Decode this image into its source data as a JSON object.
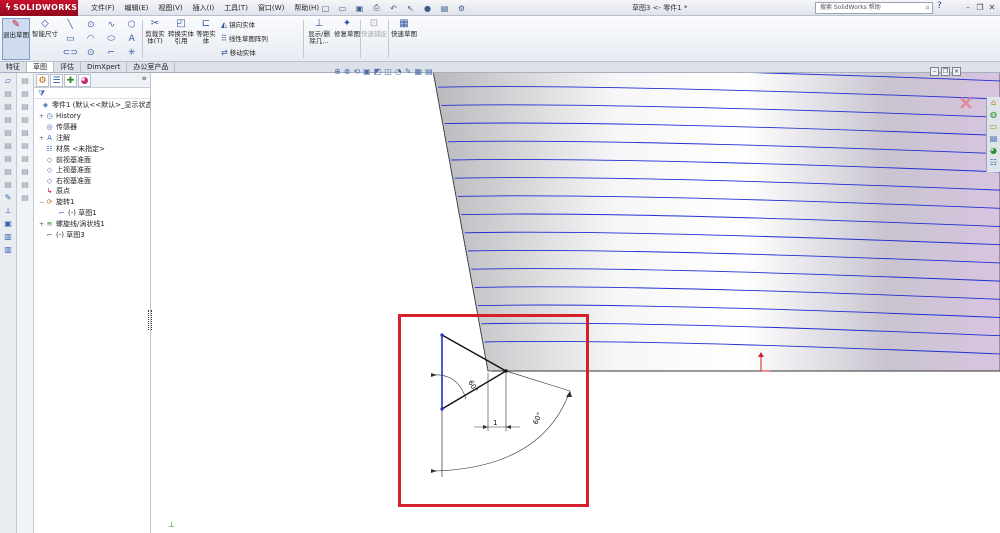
{
  "app": {
    "brand": "SOLIDWORKS",
    "doc_title": "草图3 <- 零件1 *",
    "search_placeholder": "搜索 SolidWorks 帮助"
  },
  "menu": [
    "文件(F)",
    "编辑(E)",
    "视图(V)",
    "插入(I)",
    "工具(T)",
    "窗口(W)",
    "帮助(H)"
  ],
  "commands": {
    "exit_sketch": "退出草图",
    "smart_dimension": "智能尺寸",
    "trim": "剪裁实体(T)",
    "convert": "转换实体引用",
    "offset": "等距实体",
    "mirror": "镜向实体",
    "linear_pattern": "线性草图阵列",
    "move": "移动实体",
    "show_delete": "显示/删除几...",
    "repair": "修复草图",
    "quick_snap": "快速捕捉",
    "rapid_sketch": "快速草图"
  },
  "tabs": [
    {
      "label": "特征",
      "active": false
    },
    {
      "label": "草图",
      "active": true
    },
    {
      "label": "评估",
      "active": false
    },
    {
      "label": "DimXpert",
      "active": false
    },
    {
      "label": "办公室产品",
      "active": false
    }
  ],
  "tree": [
    {
      "label": "零件1 (默认<<默认>_显示状态",
      "icon": "part-icon",
      "expand": ""
    },
    {
      "label": "History",
      "icon": "history-icon",
      "expand": "+"
    },
    {
      "label": "传感器",
      "icon": "sensor-icon",
      "expand": ""
    },
    {
      "label": "注解",
      "icon": "annotation-icon",
      "expand": "+"
    },
    {
      "label": "材质 <未指定>",
      "icon": "material-icon",
      "expand": ""
    },
    {
      "label": "前视基准面",
      "icon": "plane-icon",
      "expand": ""
    },
    {
      "label": "上视基准面",
      "icon": "plane-icon",
      "expand": ""
    },
    {
      "label": "右视基准面",
      "icon": "plane-icon",
      "expand": ""
    },
    {
      "label": "原点",
      "icon": "origin-icon",
      "expand": ""
    },
    {
      "label": "旋转1",
      "icon": "revolve-icon",
      "expand": "−"
    },
    {
      "label": "(-) 草图1",
      "icon": "sketch-icon",
      "expand": ""
    },
    {
      "label": "螺旋线/涡状线1",
      "icon": "helix-icon",
      "expand": "+"
    },
    {
      "label": "(-) 草图3",
      "icon": "sketch-icon",
      "expand": ""
    }
  ],
  "dimensions": {
    "angle_left": "60°",
    "angle_right": "60°",
    "length": "1"
  },
  "colors": {
    "helix": "#1f2fd0",
    "highlight": "#d61f2a",
    "brand": "#c8102e"
  }
}
